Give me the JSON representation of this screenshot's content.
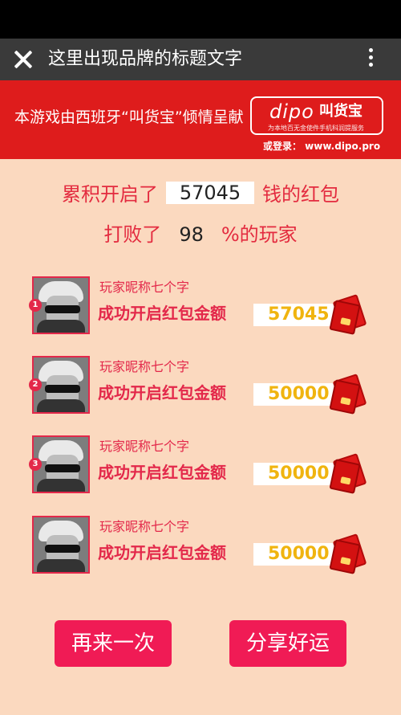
{
  "app": {
    "title": "这里出现品牌的标题文字"
  },
  "banner": {
    "sponsor_text": "本游戏由西班牙“叫货宝”倾情呈献",
    "logo_brand": "dipo",
    "logo_cn": "叫货宝",
    "logo_tagline": "为本地百无金使件手机科润提服务",
    "login_text": "或登录： www.dipo.pro"
  },
  "stats": {
    "prefix": "累积开启了",
    "total": "57045",
    "suffix": "钱的红包",
    "beat_prefix": "打败了",
    "beat_percent": "98",
    "beat_suffix": "%的玩家"
  },
  "leaderboard": [
    {
      "rank": "1",
      "nickname": "玩家昵称七个字",
      "label": "成功开启红包金额",
      "amount": "57045"
    },
    {
      "rank": "2",
      "nickname": "玩家昵称七个字",
      "label": "成功开启红包金额",
      "amount": "50000"
    },
    {
      "rank": "3",
      "nickname": "玩家昵称七个字",
      "label": "成功开启红包金额",
      "amount": "50000"
    },
    {
      "rank": "",
      "nickname": "玩家昵称七个字",
      "label": "成功开启红包金额",
      "amount": "50000"
    }
  ],
  "actions": {
    "retry_label": "再来一次",
    "share_label": "分享好运"
  },
  "colors": {
    "background": "#fbd9bf",
    "banner_red": "#de1c1c",
    "accent_pink": "#e3284a",
    "button_pink": "#f01b55",
    "amount_gold": "#f0b40f"
  }
}
